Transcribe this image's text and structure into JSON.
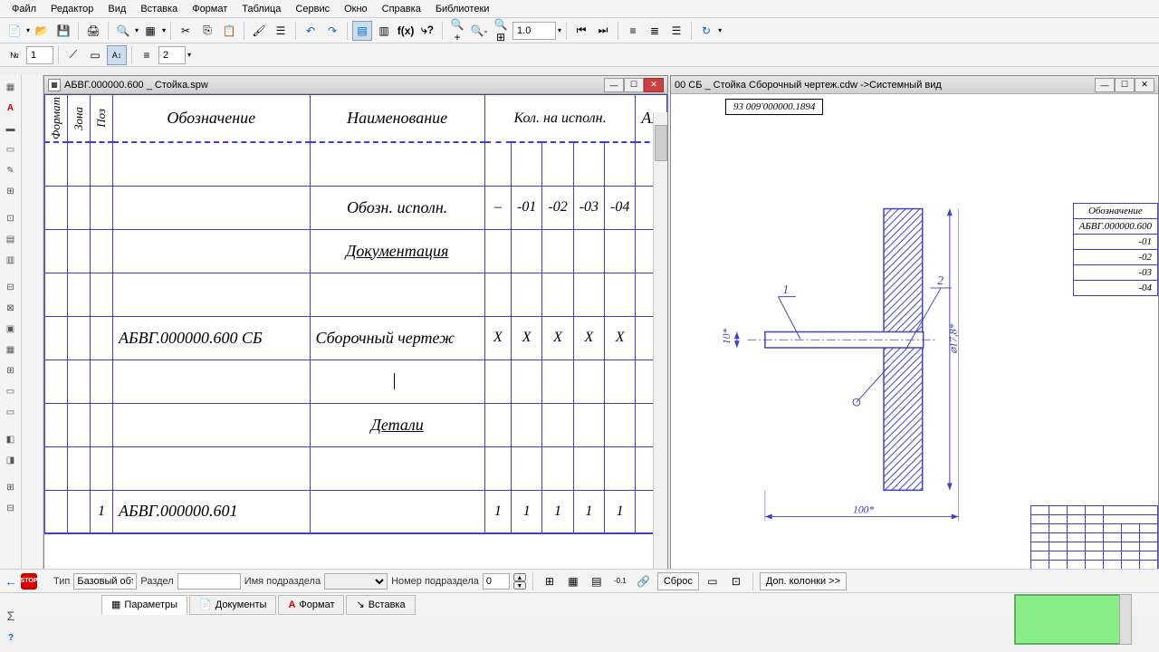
{
  "menu": {
    "items": [
      "Файл",
      "Редактор",
      "Вид",
      "Вставка",
      "Формат",
      "Таблица",
      "Сервис",
      "Окно",
      "Справка",
      "Библиотеки"
    ]
  },
  "toolbar": {
    "zoom_value": "1.0",
    "row2_num": "1",
    "row2_num2": "2"
  },
  "doc_left": {
    "title": "АБВГ.000000.600 _ Стойка.spw",
    "table": {
      "hdr_format": "Формат",
      "hdr_zona": "Зона",
      "hdr_poz": "Поз",
      "hdr_label": "Обозначение",
      "hdr_name": "Наименование",
      "hdr_count": "Кол. на исполн.",
      "hdr_ab": "АБ",
      "r_ispol": "Обозн. исполн.",
      "dash": "–",
      "n01": "-01",
      "n02": "-02",
      "n03": "-03",
      "n04": "-04",
      "r_doc": "Документация",
      "r3_label": "АБВГ.000000.600 СБ",
      "r3_name": "Сборочный чертеж",
      "x": "X",
      "r_det": "Детали",
      "r5_poz": "1",
      "r5_label": "АБВГ.000000.601",
      "one": "1"
    }
  },
  "doc_right": {
    "title": "00 СБ _ Стойка Сборочный чертеж.cdw ->Системный вид",
    "label": "93 009'000000.1894",
    "dim_h": "10*",
    "dim_w": "100*",
    "dim_d": "⌀17,8*",
    "bal1": "1",
    "bal2": "2",
    "small_table": {
      "hdr": "Обозначение",
      "r1": "АБВГ.000000.600",
      "r2": "-01",
      "r3": "-02",
      "r4": "-03",
      "r5": "-04"
    }
  },
  "bottom": {
    "type": "Тип",
    "type_val": "Базовый объ",
    "razdel": "Раздел",
    "sub_name": "Имя подраздела",
    "sub_num": "Номер подраздела",
    "sub_num_val": "0",
    "reset": "Сброс",
    "extra_cols": "Доп. колонки   >>",
    "tab_params": "Параметры",
    "tab_docs": "Документы",
    "tab_format": "Формат",
    "tab_insert": "Вставка"
  }
}
